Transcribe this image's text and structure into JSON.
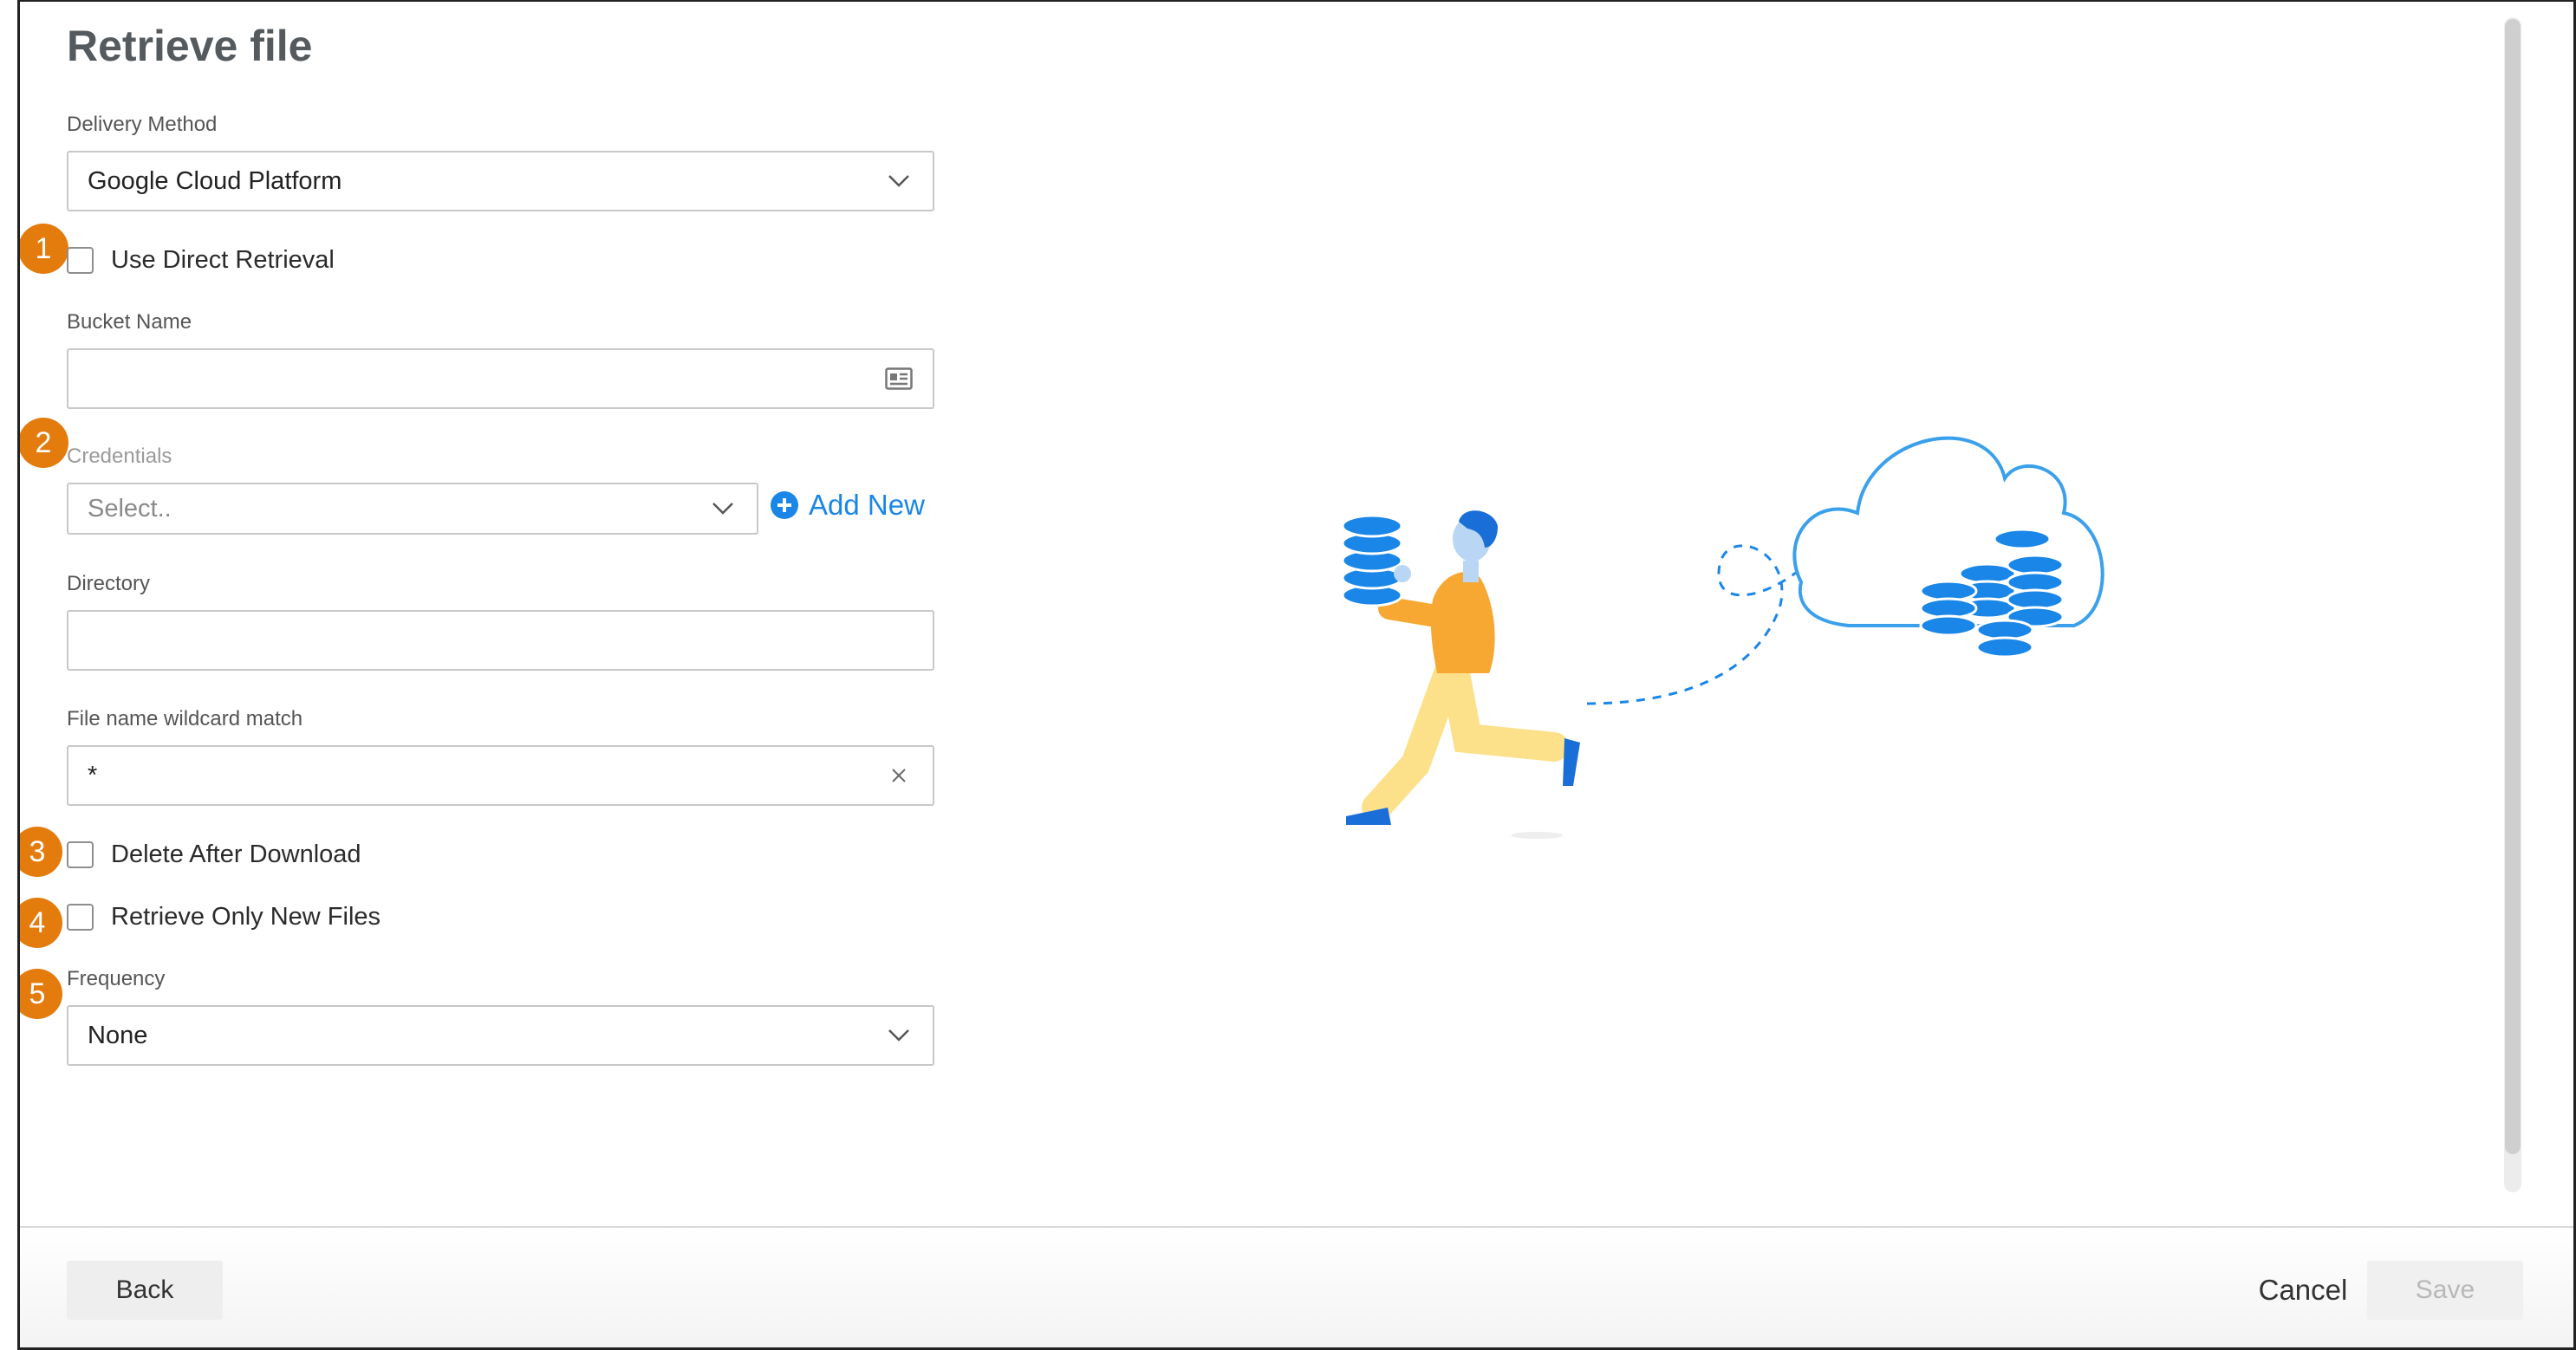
{
  "dialog": {
    "title": "Retrieve file"
  },
  "form": {
    "delivery_method": {
      "label": "Delivery Method",
      "value": "Google Cloud Platform"
    },
    "use_direct_retrieval": {
      "label": "Use Direct Retrieval",
      "checked": false
    },
    "bucket_name": {
      "label": "Bucket Name",
      "value": ""
    },
    "credentials": {
      "label": "Credentials",
      "placeholder": "Select..",
      "add_new_label": "Add New"
    },
    "directory": {
      "label": "Directory",
      "value": ""
    },
    "file_name_wildcard": {
      "label": "File name wildcard match",
      "value": "*"
    },
    "delete_after_download": {
      "label": "Delete After Download",
      "checked": false
    },
    "retrieve_only_new_files": {
      "label": "Retrieve Only New Files",
      "checked": false
    },
    "frequency": {
      "label": "Frequency",
      "value": "None"
    }
  },
  "markers": [
    "1",
    "2",
    "3",
    "4",
    "5"
  ],
  "footer": {
    "back_label": "Back",
    "cancel_label": "Cancel",
    "save_label": "Save"
  },
  "colors": {
    "accent": "#1a86e8",
    "marker": "#e47b0d",
    "figure_shirt": "#f7a832"
  },
  "icons": [
    "chevron-down-icon",
    "contact-card-icon",
    "clear-x-icon",
    "plus-circle-icon"
  ]
}
